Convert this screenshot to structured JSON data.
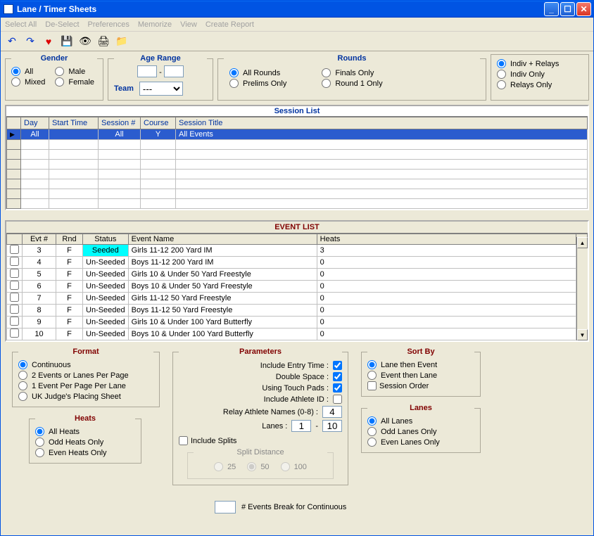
{
  "window": {
    "title": "Lane / Timer Sheets"
  },
  "menu": [
    "Select All",
    "De-Select",
    "Preferences",
    "Memorize",
    "View",
    "Create Report"
  ],
  "gender": {
    "legend": "Gender",
    "all": "All",
    "male": "Male",
    "mixed": "Mixed",
    "female": "Female"
  },
  "age": {
    "legend": "Age Range",
    "team": "Team",
    "dash": "-",
    "selected": "---"
  },
  "rounds": {
    "legend": "Rounds",
    "all": "All Rounds",
    "finals": "Finals Only",
    "prelims": "Prelims Only",
    "r1": "Round 1 Only"
  },
  "scope": {
    "both": "Indiv + Relays",
    "indiv": "Indiv Only",
    "relays": "Relays Only"
  },
  "session": {
    "title": "Session List",
    "cols": {
      "day": "Day",
      "start": "Start Time",
      "sess": "Session #",
      "course": "Course",
      "title": "Session Title"
    },
    "rows": [
      {
        "day": "All",
        "start": "",
        "sess": "All",
        "course": "Y",
        "title": "All Events"
      }
    ]
  },
  "events": {
    "title": "EVENT LIST",
    "cols": {
      "evt": "Evt #",
      "rnd": "Rnd",
      "status": "Status",
      "name": "Event Name",
      "heats": "Heats"
    },
    "rows": [
      {
        "evt": "3",
        "rnd": "F",
        "status": "Seeded",
        "name": "Girls 11-12 200 Yard IM",
        "heats": "3",
        "seeded": true
      },
      {
        "evt": "4",
        "rnd": "F",
        "status": "Un-Seeded",
        "name": "Boys 11-12 200 Yard IM",
        "heats": "0"
      },
      {
        "evt": "5",
        "rnd": "F",
        "status": "Un-Seeded",
        "name": "Girls 10 & Under 50 Yard Freestyle",
        "heats": "0"
      },
      {
        "evt": "6",
        "rnd": "F",
        "status": "Un-Seeded",
        "name": "Boys 10 & Under 50 Yard Freestyle",
        "heats": "0"
      },
      {
        "evt": "7",
        "rnd": "F",
        "status": "Un-Seeded",
        "name": "Girls 11-12 50 Yard Freestyle",
        "heats": "0"
      },
      {
        "evt": "8",
        "rnd": "F",
        "status": "Un-Seeded",
        "name": "Boys 11-12 50 Yard Freestyle",
        "heats": "0"
      },
      {
        "evt": "9",
        "rnd": "F",
        "status": "Un-Seeded",
        "name": "Girls 10 & Under 100 Yard Butterfly",
        "heats": "0"
      },
      {
        "evt": "10",
        "rnd": "F",
        "status": "Un-Seeded",
        "name": "Boys 10 & Under 100 Yard Butterfly",
        "heats": "0"
      }
    ]
  },
  "format": {
    "legend": "Format",
    "cont": "Continuous",
    "two": "2 Events or Lanes Per Page",
    "one": "1 Event Per Page Per Lane",
    "uk": "UK Judge's Placing Sheet"
  },
  "heats": {
    "legend": "Heats",
    "all": "All Heats",
    "odd": "Odd Heats Only",
    "even": "Even Heats Only"
  },
  "params": {
    "legend": "Parameters",
    "entry": "Include Entry Time :",
    "dbl": "Double Space :",
    "pads": "Using Touch Pads :",
    "ath": "Include Athlete ID :",
    "relay": "Relay Athlete Names (0-8) :",
    "relayVal": "4",
    "lanes": "Lanes :",
    "laneLo": "1",
    "dash": "-",
    "laneHi": "10",
    "splits": "Include Splits",
    "splitDist": "Split Distance",
    "d25": "25",
    "d50": "50",
    "d100": "100"
  },
  "sort": {
    "legend": "Sort By",
    "le": "Lane then Event",
    "el": "Event then Lane",
    "so": "Session Order"
  },
  "laneOpt": {
    "legend": "Lanes",
    "all": "All Lanes",
    "odd": "Odd Lanes Only",
    "even": "Even Lanes Only"
  },
  "brk": "# Events Break for Continuous"
}
